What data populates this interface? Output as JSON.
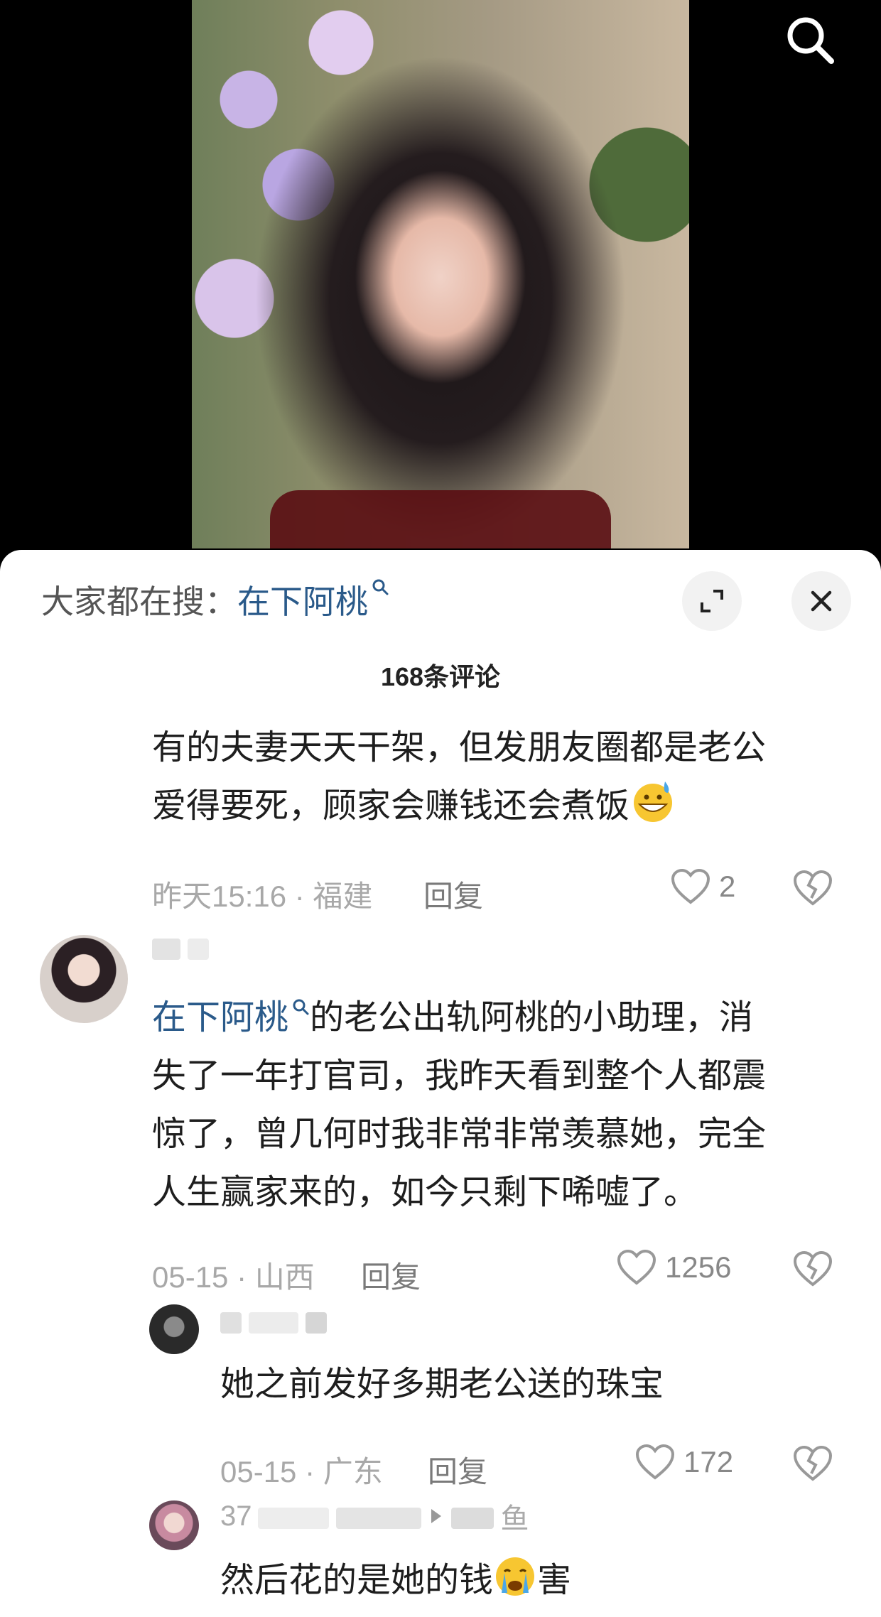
{
  "search_bar": {
    "prefix": "大家都在搜：",
    "keyword": "在下阿桃"
  },
  "comments_count": "168条评论",
  "comments": [
    {
      "line1": "有的夫妻天天干架，但发朋友圈都是老公",
      "line2": "爱得要死，顾家会赚钱还会煮饭",
      "time": "昨天15:16 · 福建",
      "reply_label": "回复",
      "likes": "2"
    },
    {
      "mention": "在下阿桃",
      "line1_rest": "的老公出轨阿桃的小助理，消",
      "line2": "失了一年打官司，我昨天看到整个人都震",
      "line3": "惊了，曾几何时我非常非常羡慕她，完全",
      "line4": "人生赢家来的，如今只剩下唏嘘了。",
      "time": "05-15 · 山西",
      "reply_label": "回复",
      "likes": "1256"
    }
  ],
  "replies": [
    {
      "text": "她之前发好多期老公送的珠宝",
      "time": "05-15 · 广东",
      "reply_label": "回复",
      "likes": "172"
    },
    {
      "name_visible": "37",
      "name_tail": "鱼",
      "text_before": "然后花的是她的钱",
      "text_after": "害"
    }
  ]
}
